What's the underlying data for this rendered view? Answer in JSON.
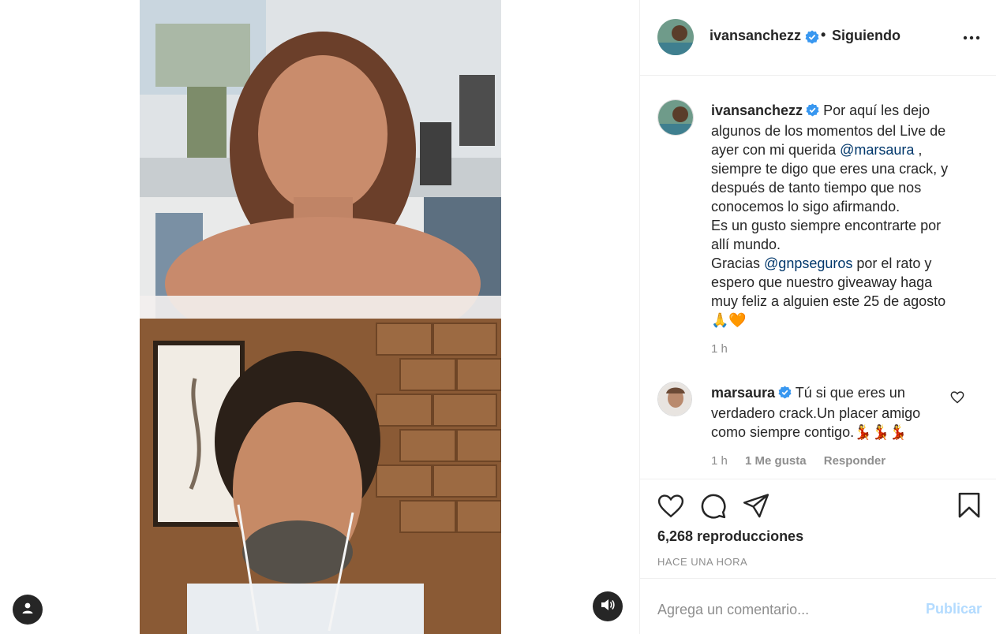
{
  "post": {
    "author": "ivansanchezz",
    "separator": "•",
    "follow_status": "Siguiendo",
    "caption": {
      "line1": "Por aquí les dejo",
      "line2": "algunos de los momentos del Live de",
      "line3_pre": "ayer con mi querida ",
      "mention1": "@marsaura",
      "line3_post": " ,",
      "line4": "siempre te digo que eres una crack, y",
      "line5": "después de tanto tiempo que nos",
      "line6": "conocemos lo sigo afirmando.",
      "line7": "Es un gusto siempre encontrarte por",
      "line8": "allí mundo.",
      "line9_pre": "Gracias ",
      "mention2": "@gnpseguros",
      "line9_post": " por el rato y",
      "line10": "espero que nuestro giveaway haga",
      "line11": "muy feliz a alguien este 25 de agosto",
      "emoji": "🙏🧡"
    },
    "caption_time": "1 h"
  },
  "comment": {
    "author": "marsaura",
    "line1": "Tú si que eres un",
    "line2": "verdadero crack.Un placer amigo",
    "line3": "como siempre contigo.",
    "emoji": "💃💃💃",
    "time": "1 h",
    "likes": "1 Me gusta",
    "reply": "Responder"
  },
  "stats": {
    "views": "6,268 reproducciones",
    "posted": "HACE UNA HORA"
  },
  "composer": {
    "placeholder": "Agrega un comentario...",
    "publish": "Publicar"
  },
  "colors": {
    "text": "#262626",
    "muted": "#8e8e8e",
    "mention": "#00376b",
    "verified": "#3897f0",
    "publish_disabled": "#b3dbff"
  },
  "icons": [
    "user-icon",
    "sound-icon",
    "verified-icon",
    "more-icon",
    "heart-icon",
    "comment-icon",
    "share-icon",
    "bookmark-icon"
  ]
}
